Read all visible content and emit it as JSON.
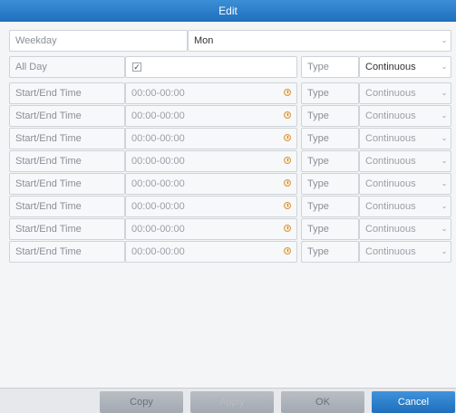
{
  "dialog": {
    "title": "Edit"
  },
  "weekday": {
    "label": "Weekday",
    "value": "Mon"
  },
  "all_day": {
    "label": "All Day",
    "checked": true,
    "check_glyph": "✓",
    "type_label": "Type",
    "type_value": "Continuous"
  },
  "chevron_glyph": "⌄",
  "time_rows": [
    {
      "label": "Start/End Time",
      "time": "00:00-00:00",
      "type_label": "Type",
      "type_value": "Continuous"
    },
    {
      "label": "Start/End Time",
      "time": "00:00-00:00",
      "type_label": "Type",
      "type_value": "Continuous"
    },
    {
      "label": "Start/End Time",
      "time": "00:00-00:00",
      "type_label": "Type",
      "type_value": "Continuous"
    },
    {
      "label": "Start/End Time",
      "time": "00:00-00:00",
      "type_label": "Type",
      "type_value": "Continuous"
    },
    {
      "label": "Start/End Time",
      "time": "00:00-00:00",
      "type_label": "Type",
      "type_value": "Continuous"
    },
    {
      "label": "Start/End Time",
      "time": "00:00-00:00",
      "type_label": "Type",
      "type_value": "Continuous"
    },
    {
      "label": "Start/End Time",
      "time": "00:00-00:00",
      "type_label": "Type",
      "type_value": "Continuous"
    },
    {
      "label": "Start/End Time",
      "time": "00:00-00:00",
      "type_label": "Type",
      "type_value": "Continuous"
    }
  ],
  "buttons": {
    "copy": "Copy",
    "apply": "Apply",
    "ok": "OK",
    "cancel": "Cancel"
  },
  "colors": {
    "title_bar": "#1f6fbd",
    "primary_button": "#1f6fbd",
    "clock_icon": "#d39a4a"
  }
}
